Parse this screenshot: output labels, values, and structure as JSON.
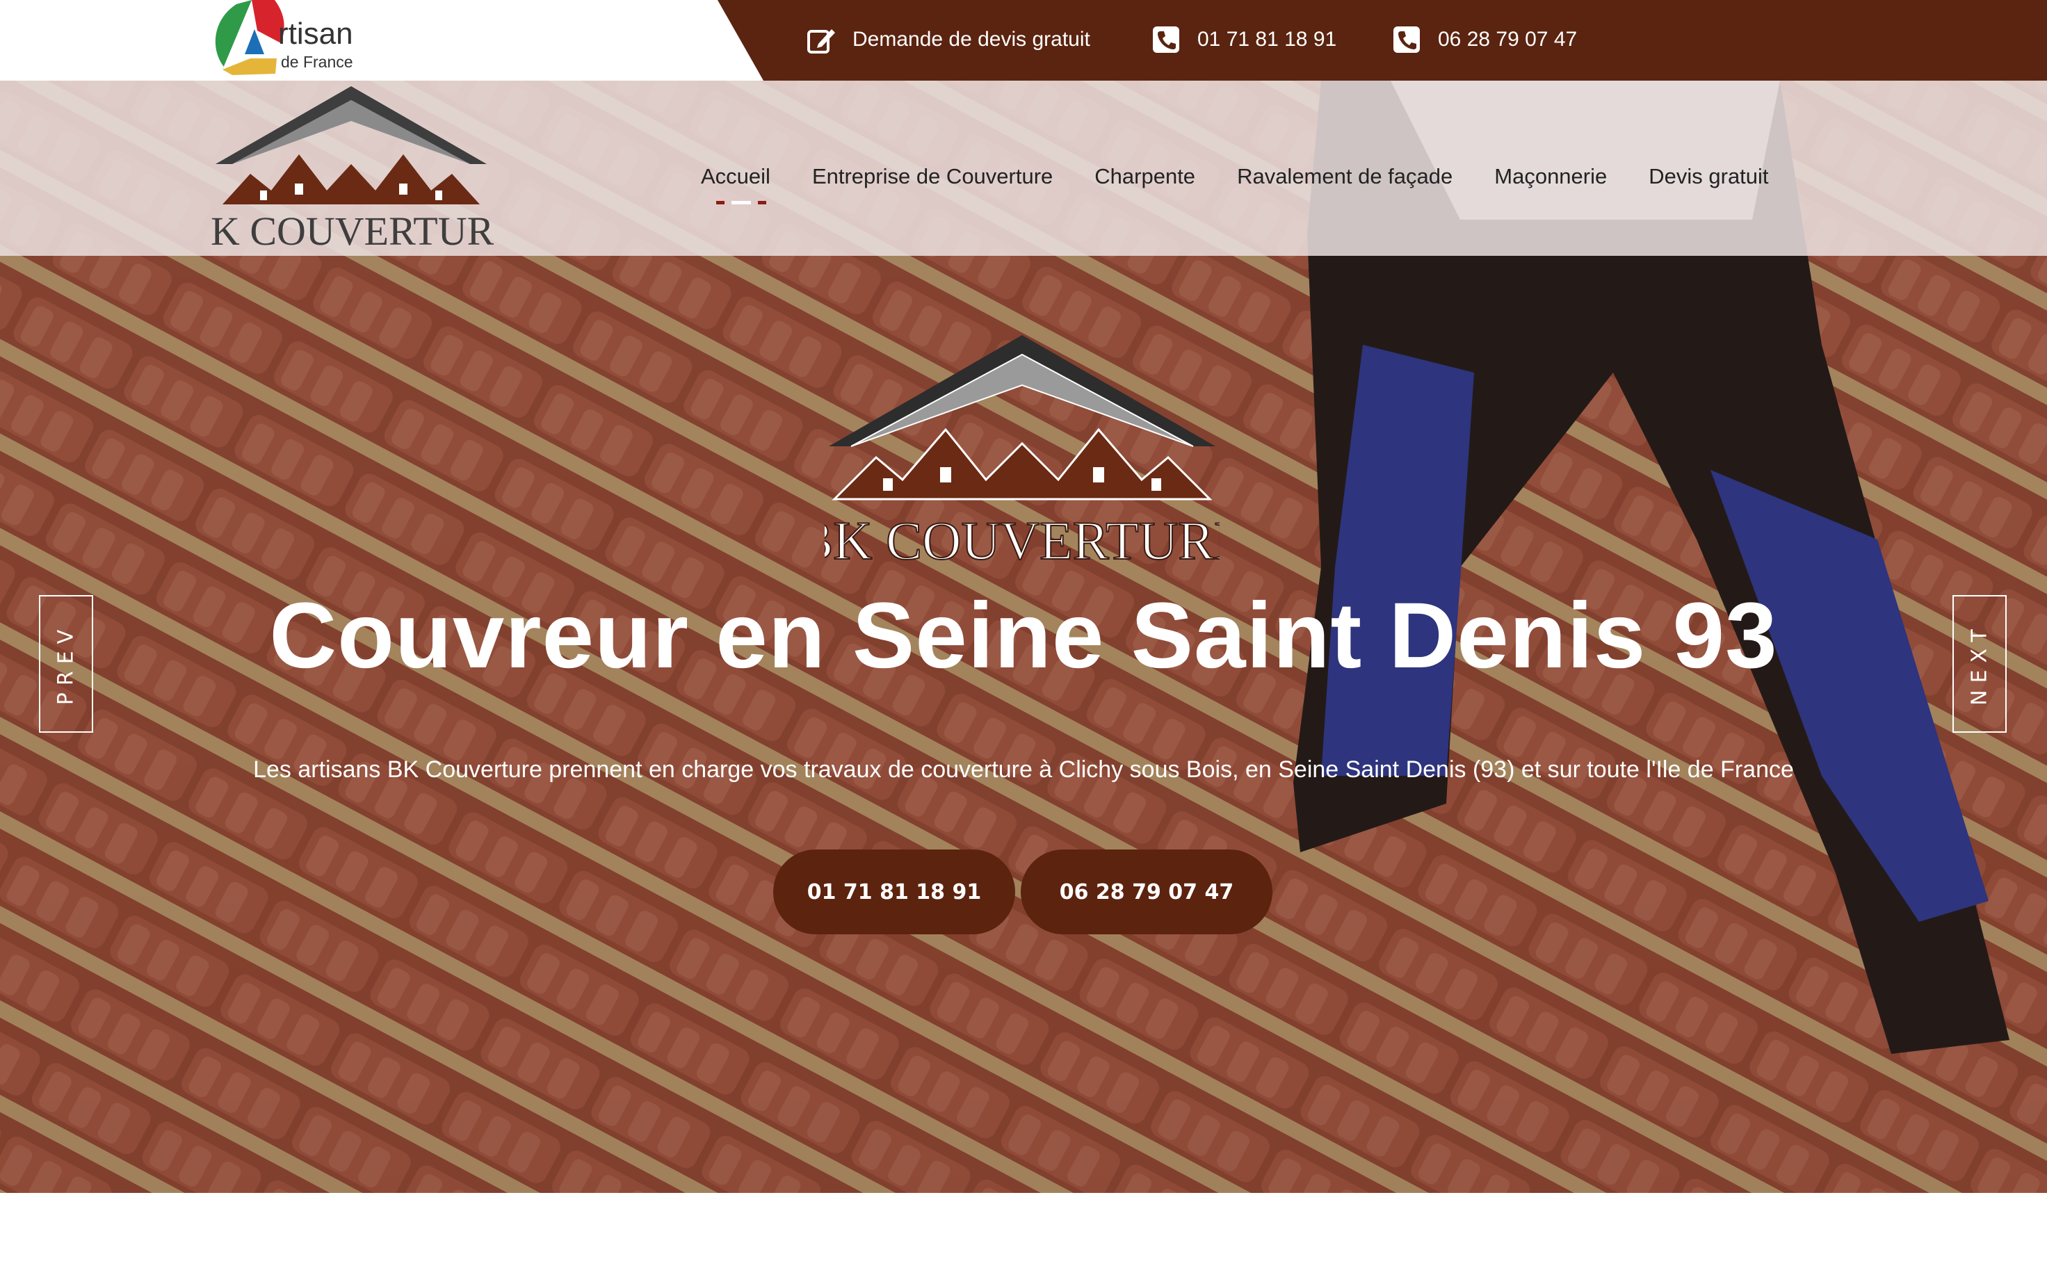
{
  "topbar": {
    "artisan_brand": "rtisan",
    "artisan_sub": "de France",
    "quote_link": "Demande de devis gratuit",
    "phone1": "01 71 81 18 91",
    "phone2": "06 28 79 07 47"
  },
  "header": {
    "logo_text": "BK Couverture",
    "nav": [
      {
        "label": "Accueil",
        "active": true
      },
      {
        "label": "Entreprise de Couverture"
      },
      {
        "label": "Charpente"
      },
      {
        "label": "Ravalement de façade"
      },
      {
        "label": "Maçonnerie"
      },
      {
        "label": "Devis gratuit"
      }
    ]
  },
  "hero": {
    "logo_text": "BK Couverture",
    "title": "Couvreur en Seine Saint Denis 93",
    "subtitle": "Les artisans BK Couverture prennent en charge vos travaux de couverture à Clichy sous Bois, en Seine Saint Denis (93) et sur toute l'Ile de France",
    "cta_phone1": "01 71 81 18 91",
    "cta_phone2": "06 28 79 07 47",
    "prev_label": "PREV",
    "next_label": "NEXT"
  },
  "colors": {
    "brand_brown": "#5a2410",
    "cta_brown": "#5c230f",
    "tile_terracotta": "#a9553f",
    "active_underline": "#8b1c14"
  },
  "icons": [
    "edit-icon",
    "phone-icon",
    "phone-icon",
    "artisan-logo-icon",
    "roof-logo-icon"
  ]
}
